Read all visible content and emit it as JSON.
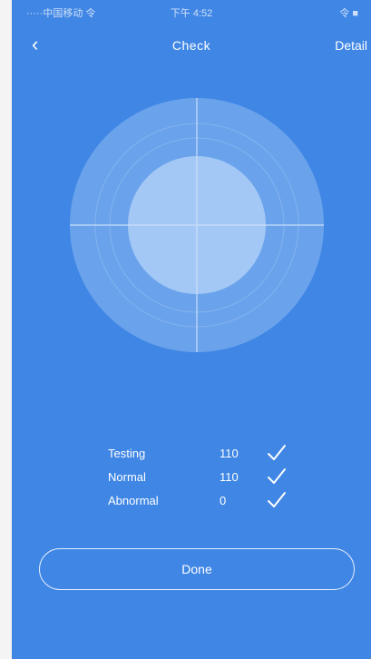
{
  "status_bar": {
    "carrier": "·····中国移动 令",
    "time": "下午 4:52",
    "battery": "令 ■"
  },
  "nav": {
    "back_icon": "chevron-left-icon",
    "back_glyph": "‹",
    "title": "Check",
    "detail_label": "Detail"
  },
  "results": [
    {
      "label": "Testing",
      "count": "110",
      "icon": "check-icon"
    },
    {
      "label": "Normal",
      "count": "110",
      "icon": "check-icon"
    },
    {
      "label": "Abnormal",
      "count": "0",
      "icon": "check-icon"
    }
  ],
  "button": {
    "label": "Done"
  },
  "colors": {
    "background": "#3f86e5",
    "radar_outer": "#6aa3ec",
    "radar_inner": "#a4c8f5",
    "text": "#ffffff"
  }
}
